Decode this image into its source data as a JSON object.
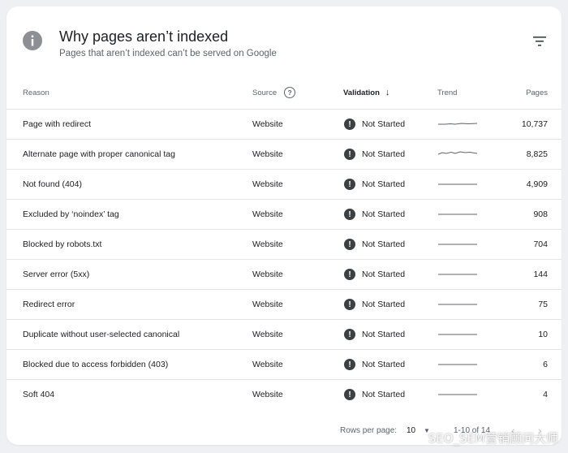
{
  "header": {
    "title": "Why pages aren’t indexed",
    "subtitle": "Pages that aren’t indexed can’t be served on Google"
  },
  "columns": {
    "reason": "Reason",
    "source": "Source",
    "validation": "Validation",
    "trend": "Trend",
    "pages": "Pages"
  },
  "rows": [
    {
      "reason": "Page with redirect",
      "source": "Website",
      "validation": "Not Started",
      "pages": "10,737"
    },
    {
      "reason": "Alternate page with proper canonical tag",
      "source": "Website",
      "validation": "Not Started",
      "pages": "8,825"
    },
    {
      "reason": "Not found (404)",
      "source": "Website",
      "validation": "Not Started",
      "pages": "4,909"
    },
    {
      "reason": "Excluded by ‘noindex’ tag",
      "source": "Website",
      "validation": "Not Started",
      "pages": "908"
    },
    {
      "reason": "Blocked by robots.txt",
      "source": "Website",
      "validation": "Not Started",
      "pages": "704"
    },
    {
      "reason": "Server error (5xx)",
      "source": "Website",
      "validation": "Not Started",
      "pages": "144"
    },
    {
      "reason": "Redirect error",
      "source": "Website",
      "validation": "Not Started",
      "pages": "75"
    },
    {
      "reason": "Duplicate without user-selected canonical",
      "source": "Website",
      "validation": "Not Started",
      "pages": "10"
    },
    {
      "reason": "Blocked due to access forbidden (403)",
      "source": "Website",
      "validation": "Not Started",
      "pages": "6"
    },
    {
      "reason": "Soft 404",
      "source": "Website",
      "validation": "Not Started",
      "pages": "4"
    }
  ],
  "footer": {
    "rows_per_page_label": "Rows per page:",
    "rows_per_page_value": "10",
    "range": "1-10 of 14"
  },
  "watermark": "SEO_SEM营销顾问大师",
  "icons": {
    "header": "info-icon",
    "filter": "filter-icon",
    "source_help": "help-icon",
    "sort": "arrow-down-icon",
    "status": "exclamation-icon",
    "prev": "chevron-left-icon",
    "next": "chevron-right-icon",
    "rows_dropdown": "caret-down-icon"
  },
  "colors": {
    "card": "#ffffff",
    "background": "#eef0f3",
    "status_icon": "#3c4043",
    "trend_line": "#5f6368"
  }
}
